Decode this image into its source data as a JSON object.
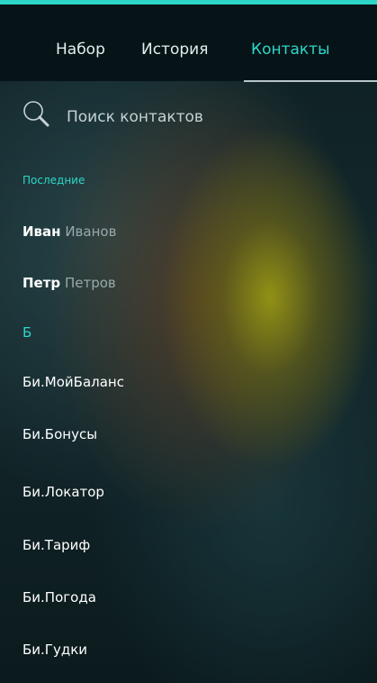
{
  "tabs": [
    {
      "label": "Набор"
    },
    {
      "label": "История"
    },
    {
      "label": "Контакты"
    }
  ],
  "search": {
    "placeholder": "Поиск контактов"
  },
  "sections": {
    "recent": "Последние",
    "letter_b": "Б"
  },
  "recent": [
    {
      "first": "Иван",
      "last": "Иванов"
    },
    {
      "first": "Петр",
      "last": "Петров"
    }
  ],
  "contacts_b": [
    "Би.МойБаланс",
    "Би.Бонусы",
    "Би.Локатор",
    "Би.Тариф",
    "Би.Погода",
    "Би.Гудки"
  ],
  "colors": {
    "accent": "#2fd6c8",
    "text": "#ffffff",
    "muted": "#98a9ac"
  }
}
